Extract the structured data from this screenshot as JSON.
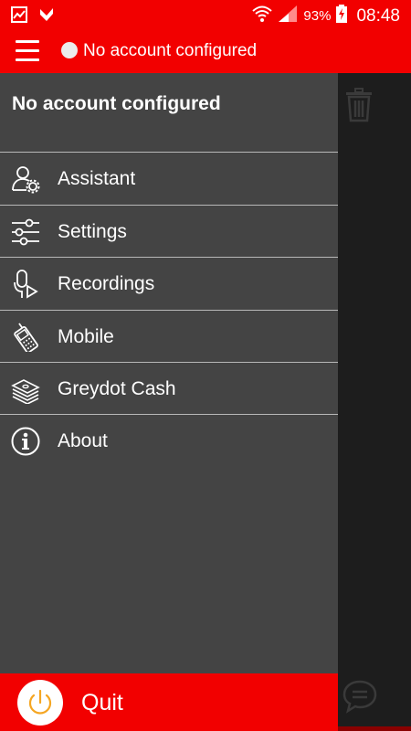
{
  "status_bar": {
    "battery_percent": "93%",
    "time": "08:48",
    "icons": [
      "gallery-notification-icon",
      "task-notification-icon",
      "wifi-icon",
      "signal-icon",
      "battery-charging-icon"
    ]
  },
  "app_bar": {
    "menu_icon": "hamburger-menu-icon",
    "account_status": "No account configured",
    "status_dot_color": "#ececec"
  },
  "drawer": {
    "header_title": "No account configured",
    "items": [
      {
        "label": "Assistant",
        "icon": "user-settings-icon"
      },
      {
        "label": "Settings",
        "icon": "sliders-icon"
      },
      {
        "label": "Recordings",
        "icon": "microphone-play-icon"
      },
      {
        "label": "Mobile",
        "icon": "mobile-phone-icon"
      },
      {
        "label": "Greydot Cash",
        "icon": "cash-stack-icon"
      },
      {
        "label": "About",
        "icon": "info-icon"
      }
    ],
    "quit_label": "Quit",
    "quit_icon": "power-icon"
  },
  "content": {
    "icons": [
      "trash-icon",
      "chat-bubble-icon"
    ]
  },
  "colors": {
    "accent": "#f20000",
    "drawer_bg": "#444444",
    "content_bg": "#1d1d1d"
  }
}
